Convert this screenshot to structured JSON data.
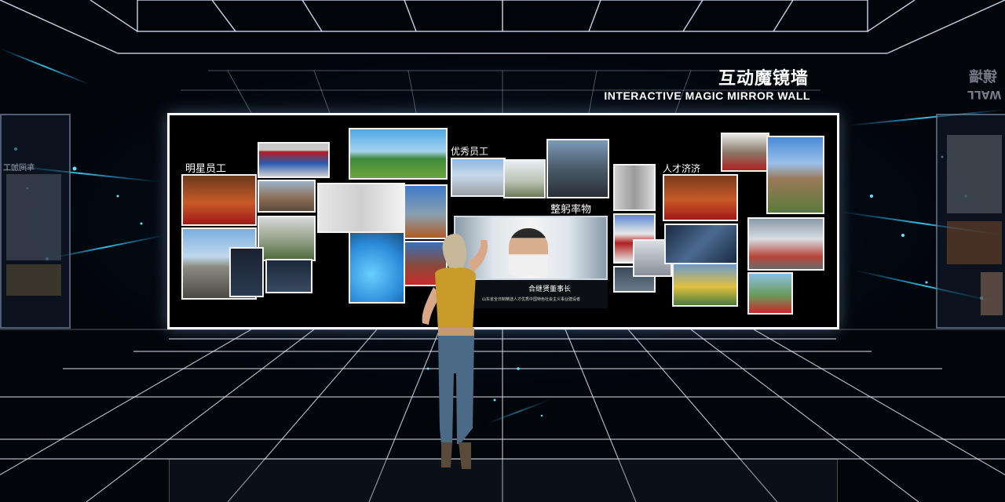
{
  "heading": {
    "title_cn": "互动魔镜墙",
    "title_en": "INTERACTIVE MAGIC MIRROR WALL"
  },
  "wall": {
    "groups": [
      {
        "label": "明星员工"
      },
      {
        "label": "优秀员工"
      },
      {
        "label": "整躬率物"
      },
      {
        "label": "人才济济"
      }
    ],
    "feature": {
      "caption_title": "合继贤董事长",
      "caption_text": "山东省全日制精选人才优秀中国特色社会主义事业建设者"
    }
  },
  "side_panels": {
    "left_label": "车间加工",
    "right_label": "镜墙",
    "right_sub": "WALL"
  },
  "colors": {
    "background": "#03060c",
    "grid": "#ffffff",
    "accent_cyan": "#2fd0ff",
    "wall_border": "#ffffff"
  }
}
